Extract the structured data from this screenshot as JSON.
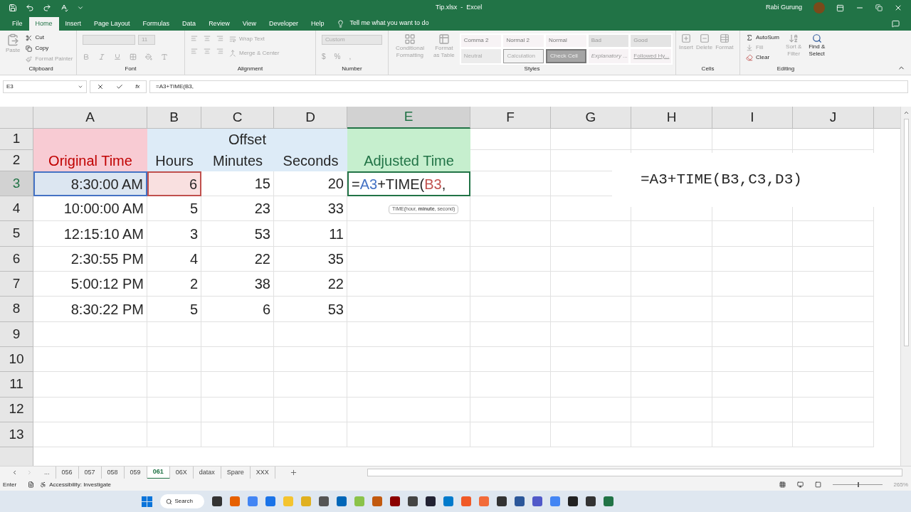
{
  "title_bar": {
    "file_name": "Tip.xlsx  -  Excel",
    "user": "Rabi Gurung"
  },
  "ribbon_tabs": [
    {
      "label": "File",
      "selected": false
    },
    {
      "label": "Home",
      "selected": true
    },
    {
      "label": "Insert",
      "selected": false
    },
    {
      "label": "Page Layout",
      "selected": false
    },
    {
      "label": "Formulas",
      "selected": false
    },
    {
      "label": "Data",
      "selected": false
    },
    {
      "label": "Review",
      "selected": false
    },
    {
      "label": "View",
      "selected": false
    },
    {
      "label": "Developer",
      "selected": false
    },
    {
      "label": "Help",
      "selected": false
    }
  ],
  "tell_me": "Tell me what you want to do",
  "ribbon": {
    "clipboard": {
      "label": "Clipboard",
      "items": [
        {
          "label": "Paste",
          "disabled": true
        },
        {
          "label": "Cut",
          "disabled": false
        },
        {
          "label": "Copy",
          "disabled": false
        },
        {
          "label": "Format Painter",
          "disabled": true
        }
      ]
    },
    "font": {
      "label": "Font",
      "size": "11"
    },
    "alignment": {
      "label": "Alignment",
      "items": [
        {
          "label": "Wrap Text",
          "disabled": true
        },
        {
          "label": "Merge & Center",
          "disabled": true
        }
      ]
    },
    "number": {
      "label": "Number",
      "format": "Custom",
      "symbols": [
        "$",
        "%",
        ","
      ]
    },
    "styles": {
      "label": "Styles",
      "conditional": "Conditional Formatting",
      "format_table": "Format as Table",
      "items": [
        {
          "label": "Comma 2",
          "kind": "plain"
        },
        {
          "label": "Normal 2",
          "kind": "plain"
        },
        {
          "label": "Normal",
          "kind": "plain"
        },
        {
          "label": "Bad",
          "kind": "bad"
        },
        {
          "label": "Good",
          "kind": "good"
        },
        {
          "label": "Neutral",
          "kind": "neutral"
        },
        {
          "label": "Calculation",
          "kind": "calculation"
        },
        {
          "label": "Check Cell",
          "kind": "check"
        },
        {
          "label": "Explanatory ...",
          "kind": "explanatory"
        },
        {
          "label": "Followed Hy...",
          "kind": "hyperlink"
        }
      ]
    },
    "cells": {
      "label": "Cells",
      "items": [
        "Insert",
        "Delete",
        "Format"
      ]
    },
    "editing": {
      "label": "Editing",
      "items": [
        {
          "label": "AutoSum",
          "disabled": false
        },
        {
          "label": "Fill",
          "disabled": true
        },
        {
          "label": "Clear",
          "disabled": false
        },
        {
          "label": "Sort & Filter",
          "disabled": true
        },
        {
          "label": "Find & Select",
          "disabled": false
        }
      ]
    }
  },
  "formula_bar": {
    "name_box": "E3",
    "insert_function": "fx",
    "formula": "=A3+TIME(B3,"
  },
  "columns": [
    {
      "label": "A",
      "selected": false
    },
    {
      "label": "B",
      "selected": false
    },
    {
      "label": "C",
      "selected": false
    },
    {
      "label": "D",
      "selected": false
    },
    {
      "label": "E",
      "selected": true
    },
    {
      "label": "F",
      "selected": false
    },
    {
      "label": "G",
      "selected": false
    },
    {
      "label": "H",
      "selected": false
    },
    {
      "label": "I",
      "selected": false
    },
    {
      "label": "J",
      "selected": false
    }
  ],
  "header_rows": [
    {
      "label": "1",
      "selected": false,
      "group": "Offset"
    },
    {
      "label": "2",
      "selected": false,
      "titles": [
        "Original Time",
        "Hours",
        "Minutes",
        "Seconds",
        "Adjusted Time"
      ]
    }
  ],
  "data_rows": [
    {
      "label": "3",
      "selected": true,
      "cells": [
        {
          "text": "8:30:00 AM",
          "color": "#4472c4"
        },
        {
          "text": "6",
          "color": "#c0504d"
        },
        {
          "text": "15"
        },
        {
          "text": "20"
        }
      ],
      "editing": [
        {
          "text": "="
        },
        {
          "text": "A3",
          "color": "#4472c4"
        },
        {
          "text": "+TIME("
        },
        {
          "text": "B3",
          "color": "#c0504d"
        },
        {
          "text": ","
        }
      ],
      "tooltip": "TIME(hour, **minute**, second)"
    },
    {
      "label": "4",
      "selected": false,
      "cells": [
        {
          "text": "10:00:00 AM"
        },
        {
          "text": "5"
        },
        {
          "text": "23"
        },
        {
          "text": "33"
        }
      ]
    },
    {
      "label": "5",
      "selected": false,
      "cells": [
        {
          "text": "12:15:10 AM"
        },
        {
          "text": "3"
        },
        {
          "text": "53"
        },
        {
          "text": "11"
        }
      ]
    },
    {
      "label": "6",
      "selected": false,
      "cells": [
        {
          "text": "2:30:55 PM"
        },
        {
          "text": "4"
        },
        {
          "text": "22"
        },
        {
          "text": "35"
        }
      ]
    },
    {
      "label": "7",
      "selected": false,
      "cells": [
        {
          "text": "5:00:12 PM"
        },
        {
          "text": "2"
        },
        {
          "text": "38"
        },
        {
          "text": "22"
        }
      ]
    },
    {
      "label": "8",
      "selected": false,
      "cells": [
        {
          "text": "8:30:22 PM"
        },
        {
          "text": "5"
        },
        {
          "text": "6"
        },
        {
          "text": "53"
        }
      ]
    },
    {
      "label": "9",
      "selected": false,
      "cells": []
    },
    {
      "label": "10",
      "selected": false,
      "cells": []
    },
    {
      "label": "11",
      "selected": false,
      "cells": []
    },
    {
      "label": "12",
      "selected": false,
      "cells": []
    },
    {
      "label": "13",
      "selected": false,
      "cells": []
    }
  ],
  "text_box": "=A3+TIME(B3,C3,D3)",
  "sheet_tabs": [
    {
      "label": "...",
      "selected": false
    },
    {
      "label": "056",
      "selected": false
    },
    {
      "label": "057",
      "selected": false
    },
    {
      "label": "058",
      "selected": false
    },
    {
      "label": "059",
      "selected": false
    },
    {
      "label": "061",
      "selected": true
    },
    {
      "label": "06X",
      "selected": false
    },
    {
      "label": "datax",
      "selected": false
    },
    {
      "label": "Spare",
      "selected": false
    },
    {
      "label": "XXX",
      "selected": false
    }
  ],
  "status_bar": {
    "mode": "Enter",
    "accessibility": "Accessibility: Investigate",
    "zoom_slider": {
      "level": 0.5
    },
    "zoom": "265%"
  },
  "taskbar": {
    "search": "Search"
  }
}
